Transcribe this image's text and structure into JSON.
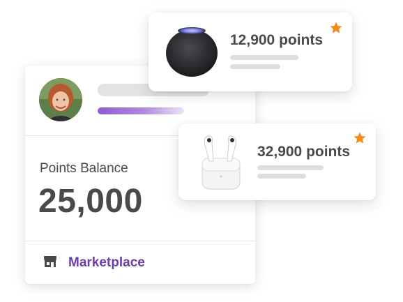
{
  "balance_card": {
    "label": "Points Balance",
    "value": "25,000",
    "progress_fraction": 0.75,
    "marketplace_label": "Marketplace",
    "store_icon": "store-icon",
    "avatar_icon": "avatar"
  },
  "products": [
    {
      "points": "12,900 points",
      "image": "smart-speaker-image",
      "favorite_icon": "star-icon"
    },
    {
      "points": "32,900 points",
      "image": "earbuds-case-image",
      "favorite_icon": "star-icon"
    }
  ],
  "colors": {
    "accent": "#6d3fa8",
    "progress": "#8e5ccf",
    "star": "#f08c1a",
    "text": "#4a4a4a"
  }
}
